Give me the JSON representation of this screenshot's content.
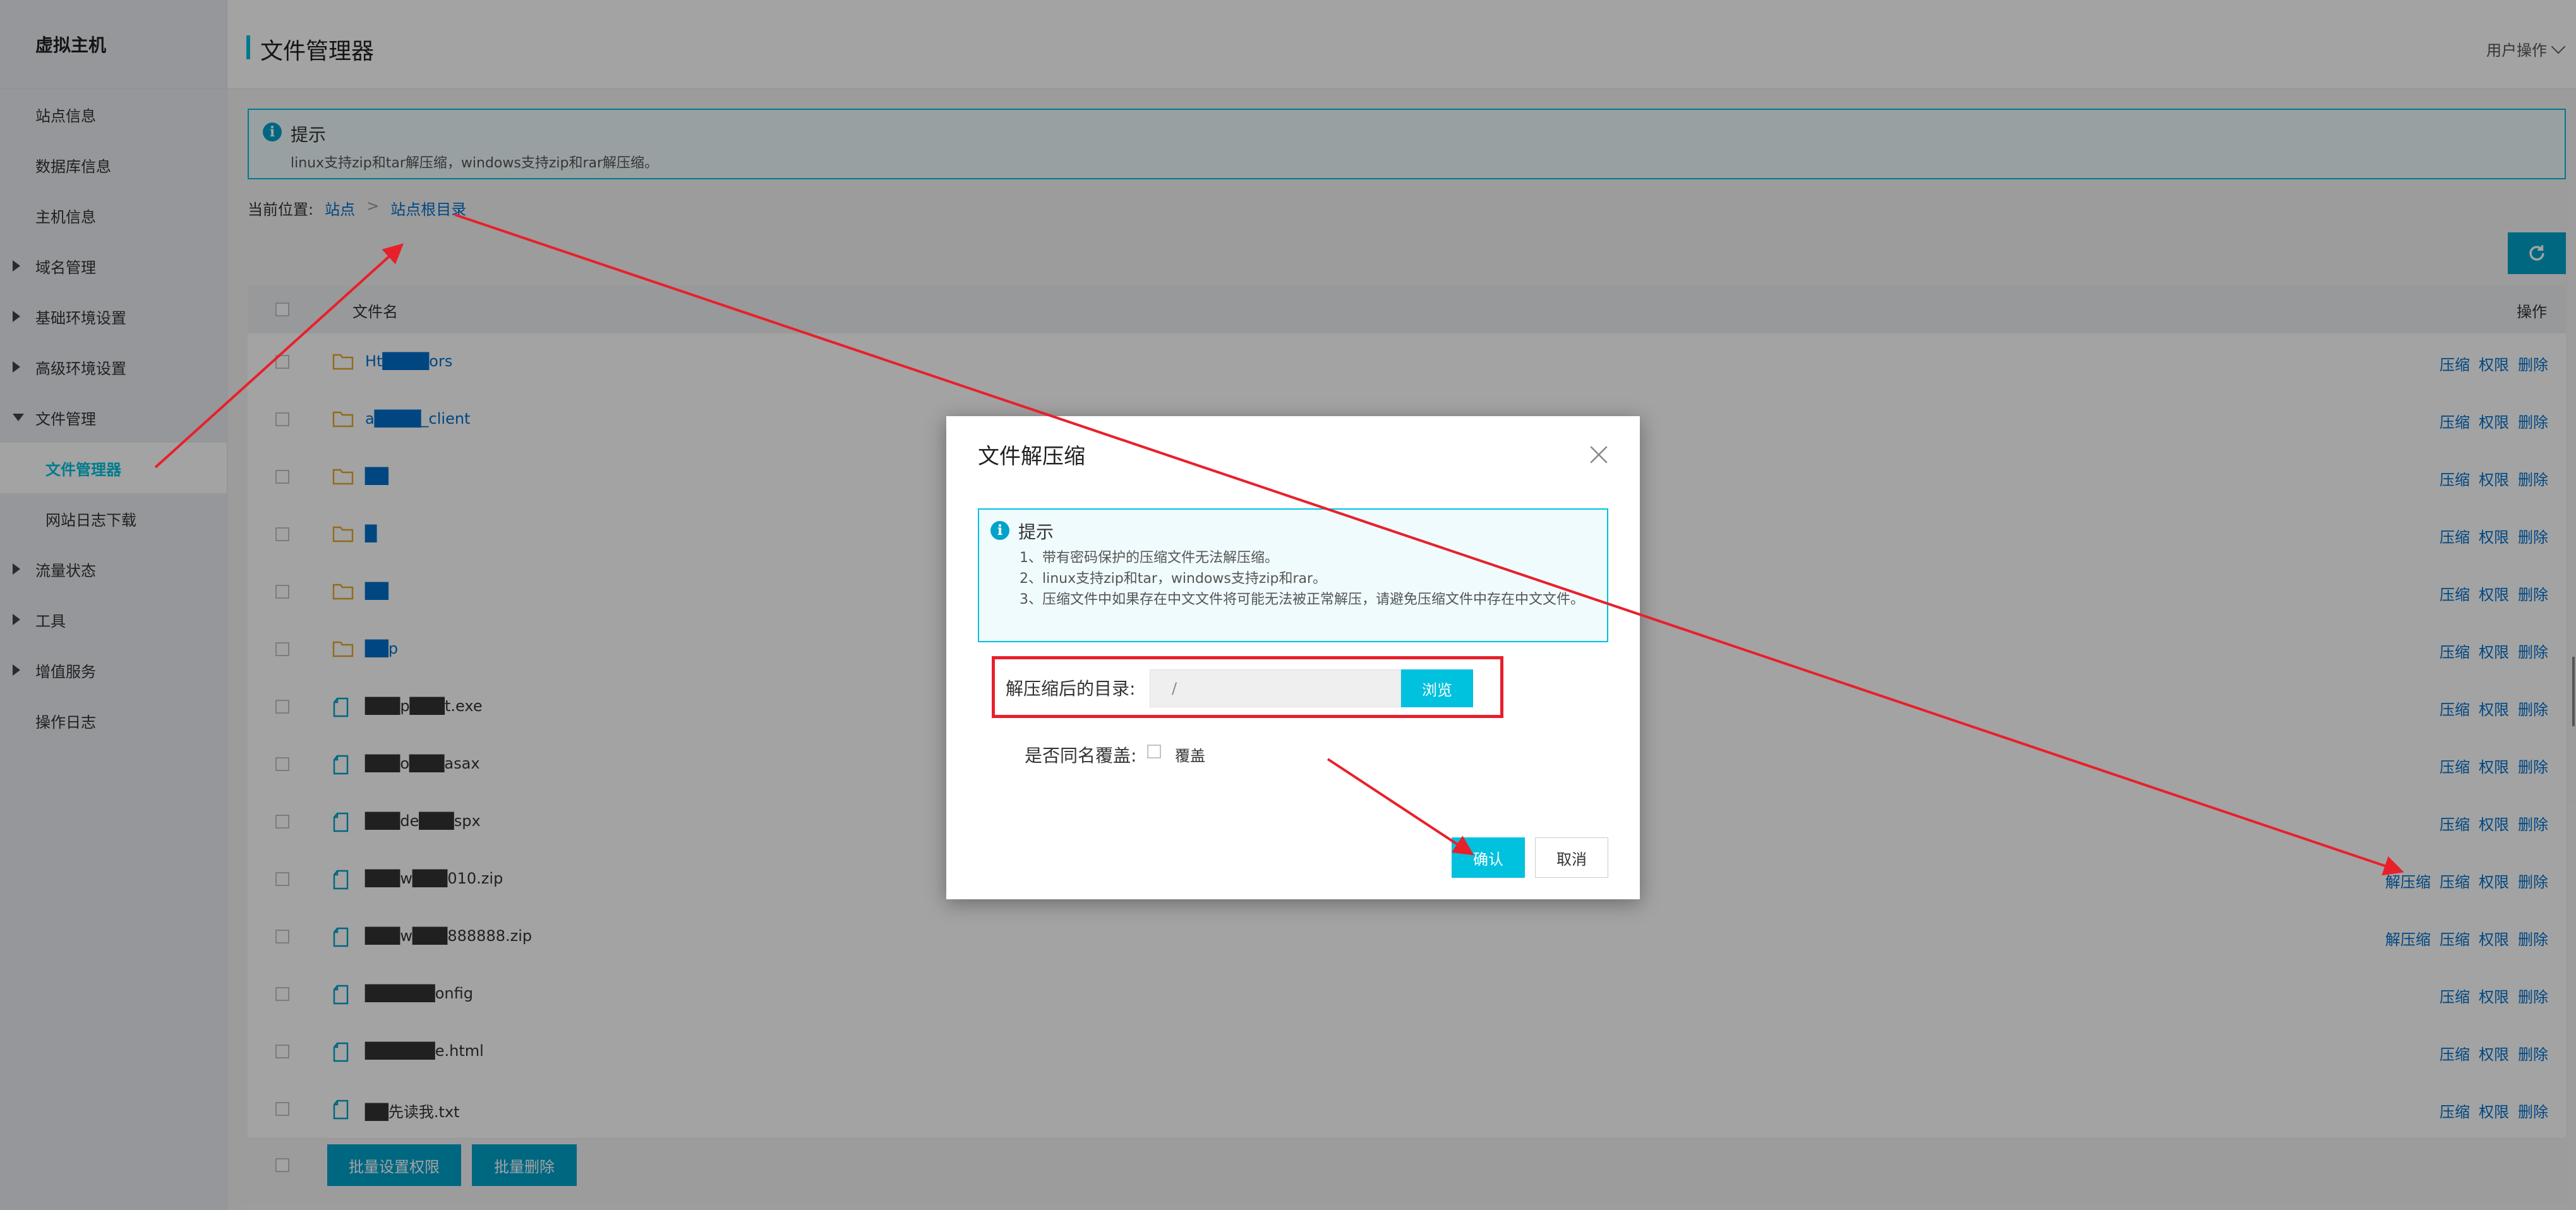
{
  "sidebar": {
    "brand": "虚拟主机",
    "items": [
      {
        "label": "站点信息"
      },
      {
        "label": "数据库信息"
      },
      {
        "label": "主机信息"
      },
      {
        "label": "域名管理"
      },
      {
        "label": "基础环境设置"
      },
      {
        "label": "高级环境设置"
      },
      {
        "label": "文件管理"
      },
      {
        "label": "文件管理器"
      },
      {
        "label": "网站日志下载"
      },
      {
        "label": "流量状态"
      },
      {
        "label": "工具"
      },
      {
        "label": "增值服务"
      },
      {
        "label": "操作日志"
      }
    ]
  },
  "header": {
    "title": "文件管理器",
    "user_ops": "用户操作"
  },
  "tip": {
    "title": "提示",
    "text": "linux支持zip和tar解压缩，windows支持zip和rar解压缩。"
  },
  "breadcrumb": {
    "label": "当前位置:",
    "root": "站点",
    "sep": ">",
    "current": "站点根目录"
  },
  "table": {
    "col_name": "文件名",
    "col_ops": "操作",
    "op_unzip": "解压缩",
    "op_zip": "压缩",
    "op_perm": "权限",
    "op_delete": "删除",
    "rows": [
      {
        "name": "Ht████ors",
        "type": "folder"
      },
      {
        "name": "a████_client",
        "type": "folder"
      },
      {
        "name": "██",
        "type": "folder"
      },
      {
        "name": "█",
        "type": "folder"
      },
      {
        "name": "██",
        "type": "folder"
      },
      {
        "name": "██p",
        "type": "folder"
      },
      {
        "name": "███p███t.exe",
        "type": "file"
      },
      {
        "name": "███o███asax",
        "type": "file"
      },
      {
        "name": "███de███spx",
        "type": "file"
      },
      {
        "name": "███w███010.zip",
        "type": "file"
      },
      {
        "name": "███w███888888.zip",
        "type": "file"
      },
      {
        "name": "██████onfig",
        "type": "file"
      },
      {
        "name": "██████e.html",
        "type": "file"
      },
      {
        "name": "██先读我.txt",
        "type": "file"
      }
    ]
  },
  "batch": {
    "set_perm": "批量设置权限",
    "delete": "批量删除"
  },
  "modal": {
    "title": "文件解压缩",
    "tip_title": "提示",
    "tip_lines": [
      "1、带有密码保护的压缩文件无法解压缩。",
      "2、linux支持zip和tar，windows支持zip和rar。",
      "3、压缩文件中如果存在中文文件将可能无法被正常解压，请避免压缩文件中存在中文文件。"
    ],
    "dir_label": "解压缩后的目录:",
    "dir_value": "/",
    "browse": "浏览",
    "overwrite_label": "是否同名覆盖:",
    "overwrite_option": "覆盖",
    "confirm": "确认",
    "cancel": "取消"
  },
  "colors": {
    "accent": "#00c1de",
    "link": "#0070cc",
    "annotation": "#e8202a"
  }
}
